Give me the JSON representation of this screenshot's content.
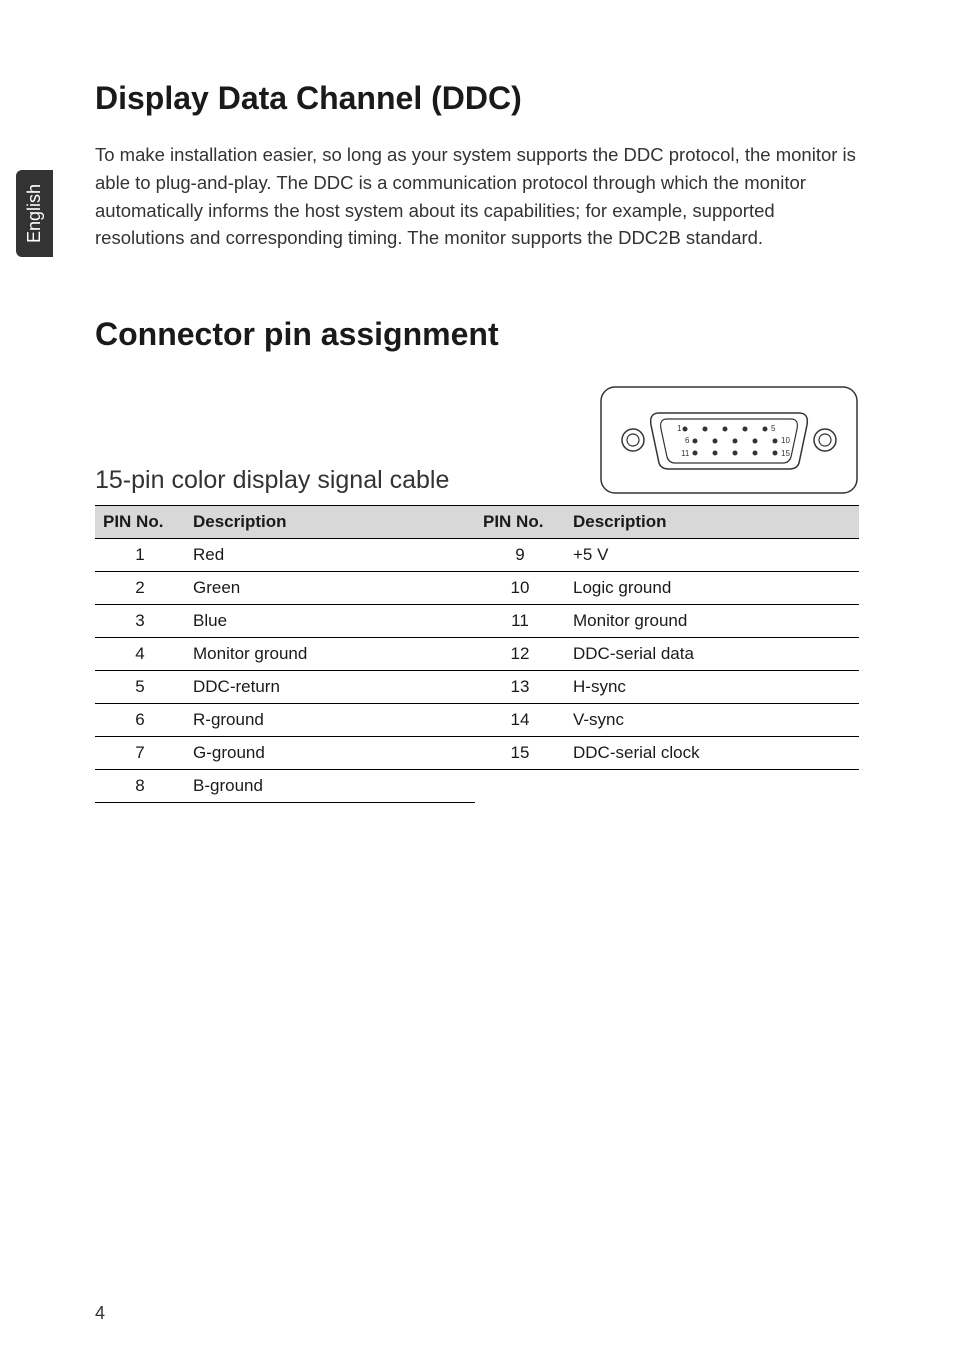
{
  "sideTab": "English",
  "heading1": "Display Data Channel (DDC)",
  "bodyText": "To make installation easier, so long as your system supports the DDC protocol, the monitor is able to plug-and-play. The DDC is a communication protocol through which the monitor automatically informs the host system about its capabilities; for example, supported resolutions and corresponding timing. The monitor supports the DDC2B standard.",
  "heading2": "Connector pin assignment",
  "heading3": "15-pin color display signal cable",
  "table": {
    "headers": {
      "pinNo": "PIN No.",
      "description": "Description"
    },
    "rows": [
      {
        "pin1": "1",
        "desc1": "Red",
        "pin2": "9",
        "desc2": "+5 V"
      },
      {
        "pin1": "2",
        "desc1": "Green",
        "pin2": "10",
        "desc2": "Logic ground"
      },
      {
        "pin1": "3",
        "desc1": "Blue",
        "pin2": "11",
        "desc2": "Monitor ground"
      },
      {
        "pin1": "4",
        "desc1": "Monitor ground",
        "pin2": "12",
        "desc2": "DDC-serial data"
      },
      {
        "pin1": "5",
        "desc1": "DDC-return",
        "pin2": "13",
        "desc2": "H-sync"
      },
      {
        "pin1": "6",
        "desc1": "R-ground",
        "pin2": "14",
        "desc2": "V-sync"
      },
      {
        "pin1": "7",
        "desc1": "G-ground",
        "pin2": "15",
        "desc2": "DDC-serial clock"
      },
      {
        "pin1": "8",
        "desc1": "B-ground",
        "pin2": "",
        "desc2": ""
      }
    ]
  },
  "connector": {
    "pinLabels": {
      "p1": "1",
      "p5": "5",
      "p6": "6",
      "p10": "10",
      "p11": "11",
      "p15": "15"
    }
  },
  "pageNumber": "4"
}
